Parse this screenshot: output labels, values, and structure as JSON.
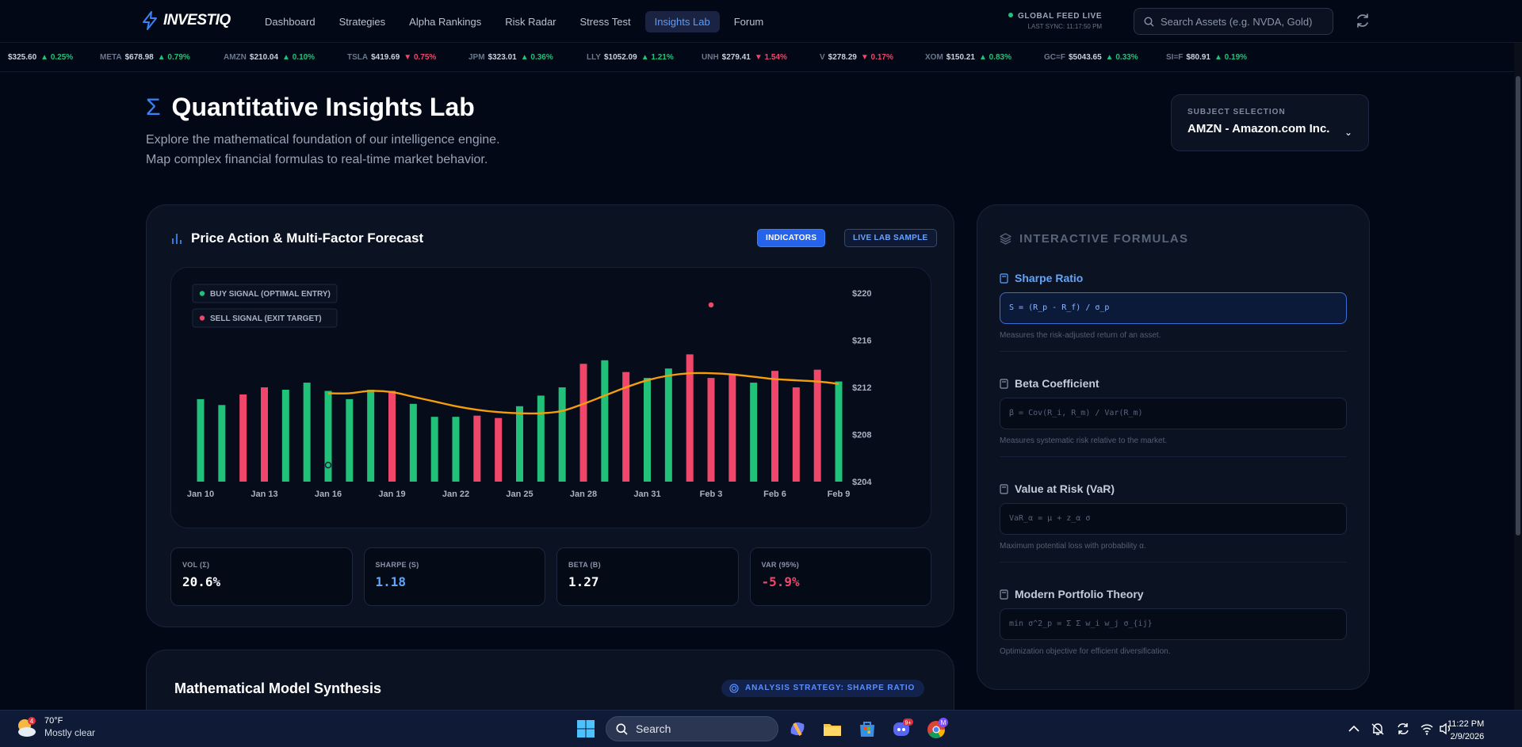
{
  "nav": {
    "brand": "INVESTIQ",
    "links": [
      "Dashboard",
      "Strategies",
      "Alpha Rankings",
      "Risk Radar",
      "Stress Test",
      "Insights Lab",
      "Forum"
    ],
    "active_link": "Insights Lab",
    "feed_status": "GLOBAL FEED LIVE",
    "last_sync": "LAST SYNC: 11:17:50 PM",
    "search_placeholder": "Search Assets (e.g. NVDA, Gold)"
  },
  "ticker": [
    {
      "sym": "",
      "price": "$325.60",
      "chg": "▲ 0.25%",
      "dir": "up"
    },
    {
      "sym": "META",
      "price": "$678.98",
      "chg": "▲ 0.79%",
      "dir": "up"
    },
    {
      "sym": "AMZN",
      "price": "$210.04",
      "chg": "▲ 0.10%",
      "dir": "up"
    },
    {
      "sym": "TSLA",
      "price": "$419.69",
      "chg": "▼ 0.75%",
      "dir": "down"
    },
    {
      "sym": "JPM",
      "price": "$323.01",
      "chg": "▲ 0.36%",
      "dir": "up"
    },
    {
      "sym": "LLY",
      "price": "$1052.09",
      "chg": "▲ 1.21%",
      "dir": "up"
    },
    {
      "sym": "UNH",
      "price": "$279.41",
      "chg": "▼ 1.54%",
      "dir": "down"
    },
    {
      "sym": "V",
      "price": "$278.29",
      "chg": "▼ 0.17%",
      "dir": "down"
    },
    {
      "sym": "XOM",
      "price": "$150.21",
      "chg": "▲ 0.83%",
      "dir": "up"
    },
    {
      "sym": "GC=F",
      "price": "$5043.65",
      "chg": "▲ 0.33%",
      "dir": "up"
    },
    {
      "sym": "SI=F",
      "price": "$80.91",
      "chg": "▲ 0.19%",
      "dir": "up"
    }
  ],
  "header": {
    "title": "Quantitative Insights Lab",
    "subtitle_line1": "Explore the mathematical foundation of our intelligence engine.",
    "subtitle_line2": "Map complex financial formulas to real-time market behavior."
  },
  "subject": {
    "label": "SUBJECT SELECTION",
    "value": "AMZN - Amazon.com Inc."
  },
  "chart_card": {
    "title": "Price Action & Multi-Factor Forecast",
    "pill_indicators": "INDICATORS",
    "pill_live": "LIVE LAB SAMPLE"
  },
  "chart_data": {
    "type": "bar",
    "legend": [
      {
        "label": "BUY SIGNAL (OPTIMAL ENTRY)",
        "color": "#22c17a"
      },
      {
        "label": "SELL SIGNAL (EXIT TARGET)",
        "color": "#f0466a"
      }
    ],
    "x_tick_labels": [
      "Jan 10",
      "Jan 13",
      "Jan 16",
      "Jan 19",
      "Jan 22",
      "Jan 25",
      "Jan 28",
      "Jan 31",
      "Feb 3",
      "Feb 6",
      "Feb 9"
    ],
    "y_tick_labels": [
      "$220",
      "$216",
      "$212",
      "$208",
      "$204"
    ],
    "ylim": [
      204,
      220
    ],
    "categories": [
      "Jan 10",
      "Jan 11",
      "Jan 12",
      "Jan 13",
      "Jan 14",
      "Jan 15",
      "Jan 16",
      "Jan 17",
      "Jan 18",
      "Jan 19",
      "Jan 20",
      "Jan 21",
      "Jan 22",
      "Jan 23",
      "Jan 24",
      "Jan 25",
      "Jan 26",
      "Jan 27",
      "Jan 28",
      "Jan 29",
      "Jan 30",
      "Jan 31",
      "Feb 1",
      "Feb 2",
      "Feb 3",
      "Feb 4",
      "Feb 5",
      "Feb 6",
      "Feb 7",
      "Feb 8",
      "Feb 9"
    ],
    "values": [
      211.0,
      210.5,
      211.4,
      212.0,
      211.8,
      212.4,
      211.7,
      211.0,
      211.8,
      211.7,
      210.6,
      209.5,
      209.5,
      209.6,
      209.4,
      210.4,
      211.3,
      212.0,
      214.0,
      214.3,
      213.3,
      212.8,
      213.6,
      214.8,
      212.8,
      213.1,
      212.4,
      213.4,
      212.0,
      213.5,
      212.5
    ],
    "signal": [
      "buy",
      "buy",
      "sell",
      "sell",
      "buy",
      "buy",
      "buy",
      "buy",
      "buy",
      "sell",
      "buy",
      "buy",
      "buy",
      "sell",
      "sell",
      "buy",
      "buy",
      "buy",
      "sell",
      "buy",
      "sell",
      "buy",
      "buy",
      "sell",
      "sell",
      "sell",
      "buy",
      "sell",
      "sell",
      "sell",
      "buy"
    ],
    "trend_series": {
      "color": "#f59e0b",
      "start_index": 6,
      "values": [
        211.5,
        211.5,
        211.7,
        211.6,
        211.2,
        210.8,
        210.4,
        210.1,
        209.9,
        209.8,
        209.8,
        210.0,
        210.6,
        211.3,
        212.0,
        212.6,
        213.0,
        213.2,
        213.2,
        213.1,
        212.9,
        212.7,
        212.6,
        212.5,
        212.3
      ]
    },
    "outlier": {
      "index": 24,
      "value": 219.0,
      "color": "#f0466a"
    },
    "grid": false
  },
  "stats": [
    {
      "key": "VOL (Σ)",
      "value": "20.6%",
      "color": "#ffffff"
    },
    {
      "key": "SHARPE (S)",
      "value": "1.18",
      "color": "#60a5fa"
    },
    {
      "key": "BETA (Β)",
      "value": "1.27",
      "color": "#ffffff"
    },
    {
      "key": "VAR (95%)",
      "value": "-5.9%",
      "color": "#f0466a"
    }
  ],
  "synthesis": {
    "title": "Mathematical Model Synthesis",
    "badge": "ANALYSIS STRATEGY: SHARPE RATIO"
  },
  "formulas": {
    "heading": "INTERACTIVE FORMULAS",
    "items": [
      {
        "name": "Sharpe Ratio",
        "formula": "S = (R_p - R_f) / σ_p",
        "desc": "Measures the risk-adjusted return of an asset."
      },
      {
        "name": "Beta Coefficient",
        "formula": "β = Cov(R_i, R_m) / Var(R_m)",
        "desc": "Measures systematic risk relative to the market."
      },
      {
        "name": "Value at Risk (VaR)",
        "formula": "VaR_α = μ + z_α σ",
        "desc": "Maximum potential loss with probability α."
      },
      {
        "name": "Modern Portfolio Theory",
        "formula": "min σ^2_p = Σ Σ w_i w_j σ_{ij}",
        "desc": "Optimization objective for efficient diversification."
      }
    ]
  },
  "taskbar": {
    "temperature": "70°F",
    "condition": "Mostly clear",
    "weather_badge": "4",
    "search_label": "Search",
    "time": "11:22 PM",
    "date": "2/9/2026",
    "discord_badge": "9+",
    "avatar_letter": "M"
  }
}
